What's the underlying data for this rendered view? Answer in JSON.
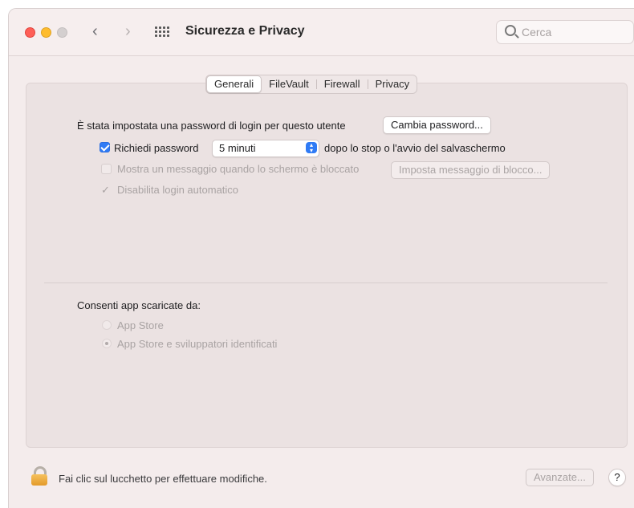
{
  "window": {
    "title": "Sicurezza e Privacy",
    "search_placeholder": "Cerca"
  },
  "tabs": [
    {
      "label": "Generali",
      "selected": true
    },
    {
      "label": "FileVault",
      "selected": false
    },
    {
      "label": "Firewall",
      "selected": false
    },
    {
      "label": "Privacy",
      "selected": false
    }
  ],
  "general": {
    "password_set_text": "È stata impostata una password di login per questo utente",
    "change_password_button": "Cambia password...",
    "require_password": {
      "label": "Richiedi password",
      "checked": true,
      "selected_option": "5 minuti",
      "suffix": "dopo lo stop o l'avvio del salvaschermo"
    },
    "show_message": {
      "label": "Mostra un messaggio quando lo schermo è bloccato",
      "checked": false,
      "enabled": false,
      "button": "Imposta messaggio di blocco..."
    },
    "disable_auto_login": {
      "label": "Disabilita login automatico",
      "checked": true,
      "enabled": false
    }
  },
  "downloads": {
    "heading": "Consenti app scaricate da:",
    "options": [
      {
        "label": "App Store",
        "selected": false
      },
      {
        "label": "App Store e sviluppatori identificati",
        "selected": true
      }
    ]
  },
  "footer": {
    "lock_text": "Fai clic sul lucchetto per effettuare modifiche.",
    "advanced_button": "Avanzate...",
    "help_label": "?"
  },
  "colors": {
    "accent": "#2f7bf5",
    "window_bg": "#f4ecec"
  }
}
